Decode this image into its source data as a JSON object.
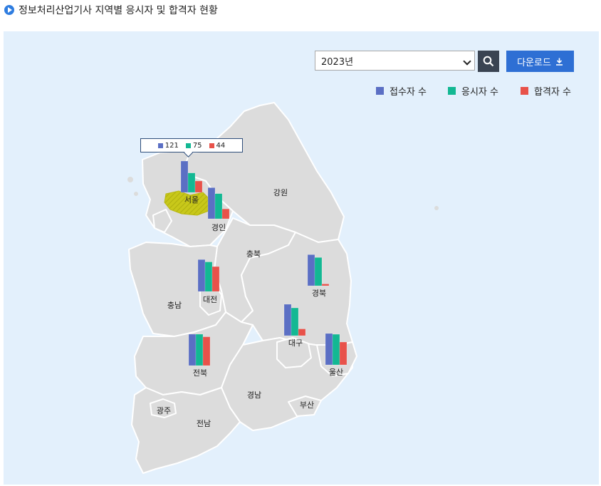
{
  "page_title": "정보처리산업기사 지역별 응시자 및 합격자 현황",
  "controls": {
    "year_selected": "2023년",
    "search_icon": "search-icon",
    "download_label": "다운로드",
    "download_icon": "download-icon"
  },
  "legend": {
    "items": [
      {
        "label": "접수자 수",
        "color": "#5b6fc4"
      },
      {
        "label": "응시자 수",
        "color": "#13b893"
      },
      {
        "label": "합격자 수",
        "color": "#e8524a"
      }
    ]
  },
  "regions": [
    {
      "label": "강원"
    },
    {
      "label": "충북"
    },
    {
      "label": "충남"
    },
    {
      "label": "경남"
    },
    {
      "label": "부산"
    },
    {
      "label": "광주"
    },
    {
      "label": "전남"
    }
  ],
  "highlight_region": "서울",
  "tooltip": {
    "region": "서울",
    "applicants": "121",
    "examinees": "75",
    "passers": "44"
  },
  "chart_data": {
    "type": "bar",
    "series_names": [
      "접수자 수",
      "응시자 수",
      "합격자 수"
    ],
    "max_value": 121,
    "regions": [
      {
        "name": "서울",
        "values": [
          121,
          75,
          44
        ]
      },
      {
        "name": "경인",
        "values": [
          120,
          97,
          38
        ]
      },
      {
        "name": "대전",
        "values": [
          123,
          114,
          96
        ]
      },
      {
        "name": "경북",
        "values": [
          120,
          109,
          7
        ]
      },
      {
        "name": "대구",
        "values": [
          121,
          107,
          26
        ]
      },
      {
        "name": "울산",
        "values": [
          121,
          118,
          88
        ]
      },
      {
        "name": "전북",
        "values": [
          121,
          121,
          111
        ]
      }
    ]
  }
}
